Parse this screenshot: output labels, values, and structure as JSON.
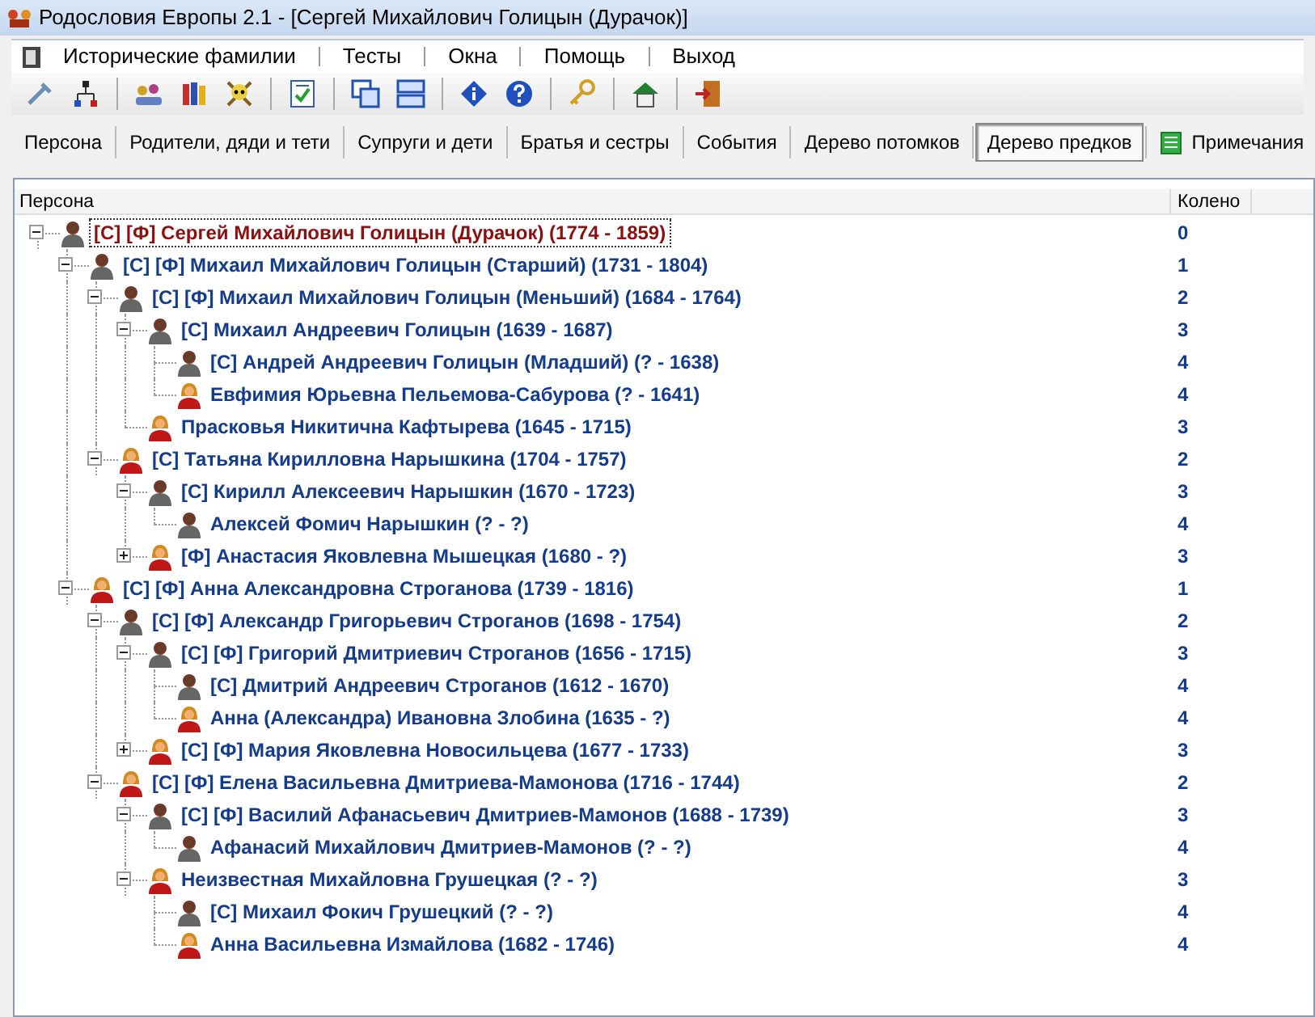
{
  "window": {
    "title": "Родословия Европы 2.1 - [Сергей Михайлович Голицын (Дурачок)]"
  },
  "menu": [
    "Исторические фамилии",
    "Тесты",
    "Окна",
    "Помощь",
    "Выход"
  ],
  "toolbar": [
    {
      "items": [
        {
          "kind": "tools"
        },
        {
          "kind": "tree"
        }
      ]
    },
    {
      "items": [
        {
          "kind": "people"
        },
        {
          "kind": "books"
        },
        {
          "kind": "skull"
        }
      ]
    },
    {
      "items": [
        {
          "kind": "checklist"
        }
      ]
    },
    {
      "items": [
        {
          "kind": "cascade"
        },
        {
          "kind": "tile"
        }
      ]
    },
    {
      "items": [
        {
          "kind": "info"
        },
        {
          "kind": "help"
        }
      ]
    },
    {
      "items": [
        {
          "kind": "key"
        }
      ]
    },
    {
      "items": [
        {
          "kind": "home"
        }
      ]
    },
    {
      "items": [
        {
          "kind": "exit"
        }
      ]
    }
  ],
  "tabs": [
    {
      "label": "Персона",
      "selected": false
    },
    {
      "label": "Родители, дяди и тети",
      "selected": false
    },
    {
      "label": "Супруги и дети",
      "selected": false
    },
    {
      "label": "Братья и сестры",
      "selected": false
    },
    {
      "label": "События",
      "selected": false
    },
    {
      "label": "Дерево потомков",
      "selected": false
    },
    {
      "label": "Дерево предков",
      "selected": true
    },
    {
      "label": "Примечания",
      "selected": false,
      "icon": true
    }
  ],
  "columns": [
    "Персона",
    "Колено"
  ],
  "tree": [
    {
      "label": "[С] [Ф] Сергей Михайлович Голицын (Дурачок) (1774 - 1859)",
      "kind": "male",
      "generation": "0",
      "expanded": true,
      "selected": true,
      "children": [
        {
          "label": "[С] [Ф] Михаил Михайлович Голицын (Старший) (1731 - 1804)",
          "kind": "male",
          "generation": "1",
          "expanded": true,
          "selected": false,
          "children": [
            {
              "label": "[С] [Ф] Михаил Михайлович Голицын (Меньший) (1684 - 1764)",
              "kind": "male",
              "generation": "2",
              "expanded": true,
              "selected": false,
              "children": [
                {
                  "label": "[С] Михаил Андреевич Голицын (1639 - 1687)",
                  "kind": "male",
                  "generation": "3",
                  "expanded": true,
                  "selected": false,
                  "children": [
                    {
                      "label": "[С] Андрей Андреевич Голицын (Младший) (? - 1638)",
                      "kind": "male",
                      "generation": "4",
                      "selected": false
                    },
                    {
                      "label": "Евфимия Юрьевна Пельемова-Сабурова (? - 1641)",
                      "kind": "female",
                      "generation": "4",
                      "selected": false
                    }
                  ]
                },
                {
                  "label": "Прасковья Никитична Кафтырева (1645 - 1715)",
                  "kind": "female",
                  "generation": "3",
                  "selected": false
                }
              ]
            },
            {
              "label": "[С] Татьяна Кирилловна Нарышкина (1704 - 1757)",
              "kind": "female",
              "generation": "2",
              "expanded": true,
              "selected": false,
              "children": [
                {
                  "label": "[С] Кирилл Алексеевич Нарышкин (1670 - 1723)",
                  "kind": "male",
                  "generation": "3",
                  "expanded": true,
                  "selected": false,
                  "children": [
                    {
                      "label": "Алексей Фомич Нарышкин (? - ?)",
                      "kind": "male",
                      "generation": "4",
                      "selected": false
                    }
                  ]
                },
                {
                  "label": "[Ф] Анастасия Яковлевна Мышецкая (1680 - ?)",
                  "kind": "female",
                  "generation": "3",
                  "expanded": false,
                  "selected": false
                }
              ]
            }
          ]
        },
        {
          "label": "[С] [Ф] Анна Александровна Строганова (1739 - 1816)",
          "kind": "female",
          "generation": "1",
          "expanded": true,
          "selected": false,
          "children": [
            {
              "label": "[С] [Ф] Александр Григорьевич Строганов (1698 - 1754)",
              "kind": "male",
              "generation": "2",
              "expanded": true,
              "selected": false,
              "children": [
                {
                  "label": "[С] [Ф] Григорий Дмитриевич Строганов (1656 - 1715)",
                  "kind": "male",
                  "generation": "3",
                  "expanded": true,
                  "selected": false,
                  "children": [
                    {
                      "label": "[С] Дмитрий Андреевич Строганов (1612 - 1670)",
                      "kind": "male",
                      "generation": "4",
                      "selected": false
                    },
                    {
                      "label": "Анна (Александра) Ивановна Злобина (1635 - ?)",
                      "kind": "female",
                      "generation": "4",
                      "selected": false
                    }
                  ]
                },
                {
                  "label": "[С] [Ф] Мария Яковлевна Новосильцева (1677 - 1733)",
                  "kind": "female",
                  "generation": "3",
                  "expanded": false,
                  "selected": false
                }
              ]
            },
            {
              "label": "[С] [Ф] Елена Васильевна Дмитриева-Мамонова (1716 - 1744)",
              "kind": "female",
              "generation": "2",
              "expanded": true,
              "selected": false,
              "children": [
                {
                  "label": "[С] [Ф] Василий Афанасьевич Дмитриев-Мамонов (1688 - 1739)",
                  "kind": "male",
                  "generation": "3",
                  "expanded": true,
                  "selected": false,
                  "children": [
                    {
                      "label": "Афанасий Михайлович Дмитриев-Мамонов (? - ?)",
                      "kind": "male",
                      "generation": "4",
                      "selected": false
                    }
                  ]
                },
                {
                  "label": "Неизвестная Михайловна Грушецкая (? - ?)",
                  "kind": "female",
                  "generation": "3",
                  "expanded": true,
                  "selected": false,
                  "children": [
                    {
                      "label": "[С] Михаил Фокич Грушецкий (? - ?)",
                      "kind": "male",
                      "generation": "4",
                      "selected": false
                    },
                    {
                      "label": "Анна Васильевна Измайлова (1682 - 1746)",
                      "kind": "female",
                      "generation": "4",
                      "selected": false
                    }
                  ]
                }
              ]
            }
          ]
        }
      ]
    }
  ]
}
